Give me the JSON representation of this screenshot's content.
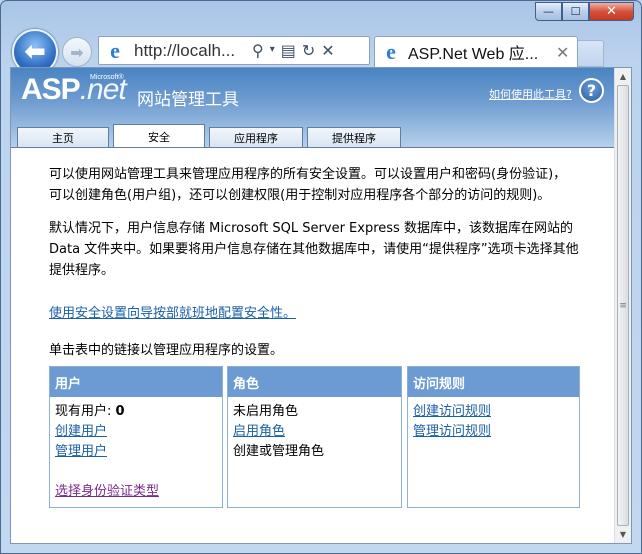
{
  "window": {
    "minimize": "—",
    "maximize": "☐",
    "close": "✕"
  },
  "nav": {
    "back_icon": "arrow-left-icon",
    "forward_icon": "arrow-right-icon"
  },
  "address_bar": {
    "value": "http://localh...",
    "icons": [
      "search-icon",
      "dropdown-icon",
      "compat-icon",
      "refresh-icon",
      "stop-icon"
    ]
  },
  "browser_tab": {
    "title": "ASP.Net Web 应...",
    "close": "✕"
  },
  "header": {
    "logo_asp": "ASP",
    "logo_net": ".net",
    "logo_ms": "Microsoft®",
    "title": "网站管理工具",
    "help_link": "如何使用此工具?",
    "help_icon": "?"
  },
  "tabs": [
    {
      "label": "主页",
      "active": false
    },
    {
      "label": "安全",
      "active": true
    },
    {
      "label": "应用程序",
      "active": false
    },
    {
      "label": "提供程序",
      "active": false
    }
  ],
  "content": {
    "para1": "可以使用网站管理工具来管理应用程序的所有安全设置。可以设置用户和密码(身份验证)，可以创建角色(用户组)，还可以创建权限(用于控制对应用程序各个部分的访问的规则)。",
    "para2": "默认情况下，用户信息存储 Microsoft SQL Server Express 数据库中，该数据库在网站的 Data 文件夹中。如果要将用户信息存储在其他数据库中，请使用“提供程序”选项卡选择其他提供程序。",
    "wizard_link": "使用安全设置向导按部就班地配置安全性。",
    "table_intro": "单击表中的链接以管理应用程序的设置。"
  },
  "columns": {
    "users": {
      "header": "用户",
      "existing_label": "现有用户:",
      "existing_count": "0",
      "create_link": "创建用户",
      "manage_link": "管理用户",
      "auth_link": "选择身份验证类型"
    },
    "roles": {
      "header": "角色",
      "status": "未启用角色",
      "enable_link": "启用角色",
      "manage_text": "创建或管理角色"
    },
    "access": {
      "header": "访问规则",
      "create_link": "创建访问规则",
      "manage_link": "管理访问规则"
    }
  },
  "colors": {
    "header_blue": "#4a84c3",
    "column_header": "#6b9bd2",
    "link": "#1a5fa8",
    "visited_link": "#7a2a8c"
  }
}
